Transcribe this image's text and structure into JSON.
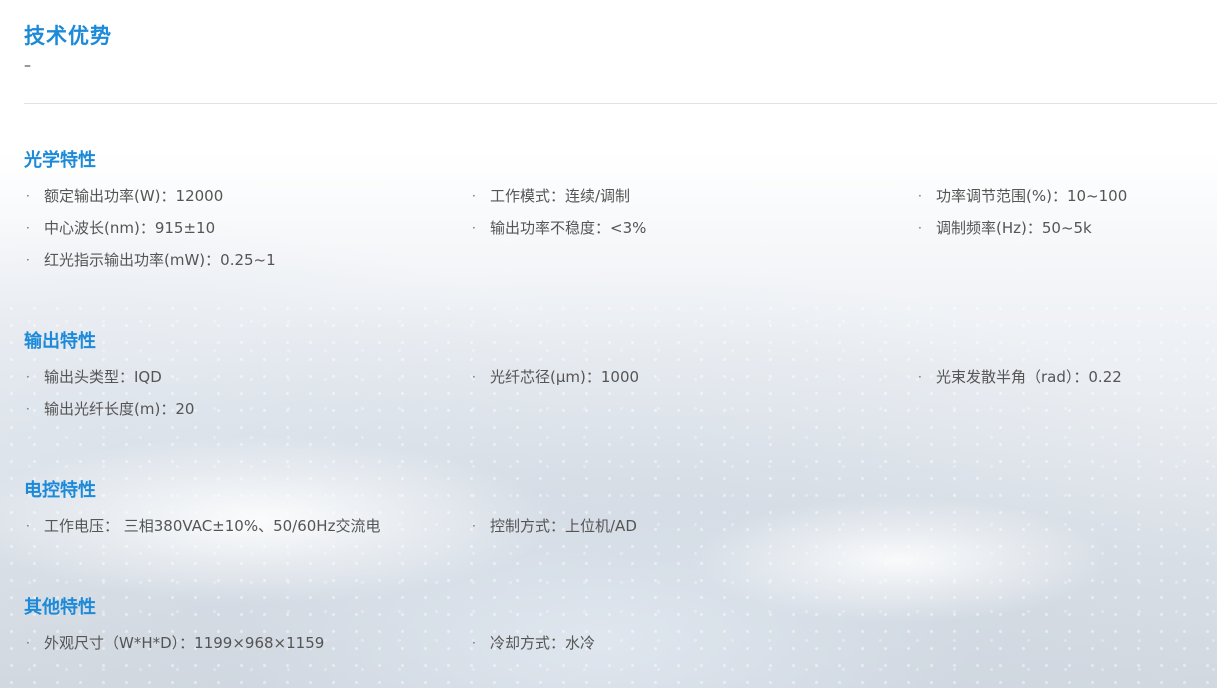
{
  "page": {
    "title": "技术优势",
    "dash": "–"
  },
  "bullet": "·",
  "sections": [
    {
      "title": "光学特性",
      "items": [
        "额定输出功率(W)：12000",
        "工作模式：连续/调制",
        "功率调节范围(%)：10~100",
        "中心波长(nm)：915±10",
        "输出功率不稳度：<3%",
        "调制频率(Hz)：50~5k",
        "红光指示输出功率(mW)：0.25~1"
      ]
    },
    {
      "title": "输出特性",
      "items": [
        "输出头类型：IQD",
        "光纤芯径(μm)：1000",
        "光束发散半角（rad）：0.22",
        "输出光纤长度(m)：20"
      ]
    },
    {
      "title": "电控特性",
      "items": [
        "工作电压： 三相380VAC±10%、50/60Hz交流电",
        "控制方式：上位机/AD"
      ]
    },
    {
      "title": "其他特性",
      "items": [
        "外观尺寸（W*H*D）：1199×968×1159",
        "冷却方式：水冷"
      ]
    }
  ]
}
